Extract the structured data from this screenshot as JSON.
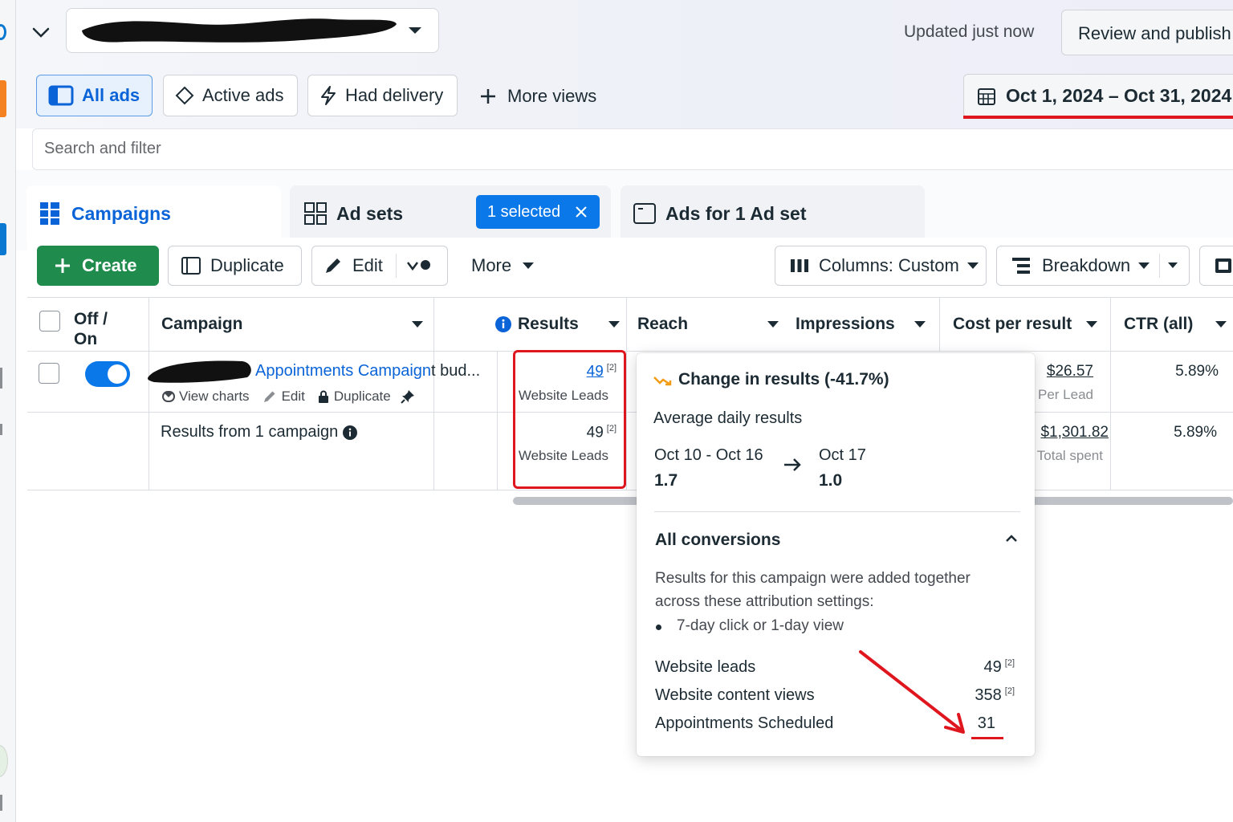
{
  "header": {
    "updated": "Updated just now",
    "review_publish": "Review and publish"
  },
  "views": {
    "all_ads": "All ads",
    "active_ads": "Active ads",
    "had_delivery": "Had delivery",
    "more_views": "More views"
  },
  "date_range": "Oct 1, 2024 – Oct 31, 2024",
  "search": {
    "placeholder": "Search and filter"
  },
  "tabs": {
    "campaigns": "Campaigns",
    "ad_sets": "Ad sets",
    "selected_chip": "1 selected",
    "ads": "Ads for 1 Ad set"
  },
  "toolbar": {
    "create": "Create",
    "duplicate": "Duplicate",
    "edit": "Edit",
    "more": "More",
    "columns": "Columns: Custom",
    "breakdown": "Breakdown"
  },
  "table": {
    "headers": {
      "off_on": "Off /",
      "off_on_2": "On",
      "campaign": "Campaign",
      "results": "Results",
      "reach": "Reach",
      "impressions": "Impressions",
      "cost_per_result": "Cost per result",
      "ctr": "CTR (all)"
    },
    "row": {
      "campaign_name": "Appointments Campaign",
      "campaign_name_tail": "t bud...",
      "view_charts": "View charts",
      "edit": "Edit",
      "duplicate": "Duplicate",
      "results_value": "49",
      "results_sup": "[2]",
      "results_label": "Website Leads",
      "cost": "$26.57",
      "cost_label": "Per Lead",
      "ctr": "5.89%"
    },
    "summary": {
      "label": "Results from 1 campaign",
      "results_value": "49",
      "results_sup": "[2]",
      "results_label": "Website Leads",
      "cost": "$1,301.82",
      "cost_label": "Total spent",
      "ctr": "5.89%"
    }
  },
  "popover": {
    "title": "Change in results (-41.7%)",
    "subtitle": "Average daily results",
    "from_label": "Oct 10 - Oct 16",
    "from_value": "1.7",
    "to_label": "Oct 17",
    "to_value": "1.0",
    "section_title": "All conversions",
    "desc_line1": "Results for this campaign were added together",
    "desc_line2": "across these attribution settings:",
    "bullet": "7-day click or 1-day view",
    "rows": [
      {
        "label": "Website leads",
        "value": "49",
        "sup": "[2]"
      },
      {
        "label": "Website content views",
        "value": "358",
        "sup": "[2]"
      },
      {
        "label": "Appointments Scheduled",
        "value": "31",
        "sup": ""
      }
    ]
  },
  "colors": {
    "accent_blue": "#0a64d8",
    "create_green": "#1f8b4c",
    "annotation_red": "#e0161e"
  }
}
